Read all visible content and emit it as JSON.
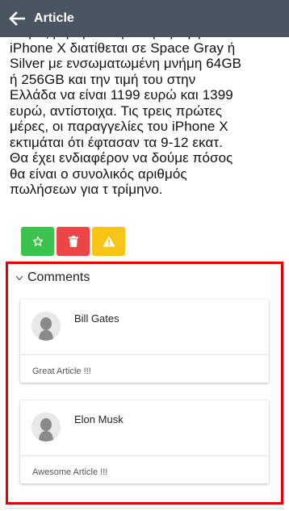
{
  "header": {
    "title": "Article",
    "back_icon": "back-arrow-icon"
  },
  "article": {
    "lines": [
      "στην ζήτηση και την παραγωγή. Το",
      "iPhone X διατίθεται σε Space Gray ή",
      "Silver με ενσωματωμένη μνήμη 64GB",
      "ή 256GB και την τιμή του στην",
      "Ελλάδα να είναι 1199 ευρώ και 1399",
      "ευρώ, αντίστοιχα. Τις τρεις πρώτες",
      "μέρες, οι παραγγελίες του iPhone X",
      "εκτιμάται ότι έφτασαν τα 9-12 εκατ.",
      "Θα έχει ενδιαφέρον να δούμε πόσος",
      "θα είναι ο συνολικός αριθμός",
      "πωλήσεων για τ τρίμηνο."
    ]
  },
  "actions": {
    "star_icon": "star-icon",
    "trash_icon": "trash-icon",
    "warning_icon": "warning-icon",
    "colors": {
      "star": "#3cc24e",
      "trash": "#ec4545",
      "warning": "#f7c515"
    }
  },
  "comments": {
    "title": "Comments",
    "toggle_icon": "chevron-down-icon",
    "highlight_color": "#e40000",
    "items": [
      {
        "author": "Bill Gates",
        "text": "Great Article !!!"
      },
      {
        "author": "Elon Musk",
        "text": "Awesome Article !!!"
      }
    ]
  },
  "theme": {
    "topbar": "#4a5560"
  }
}
